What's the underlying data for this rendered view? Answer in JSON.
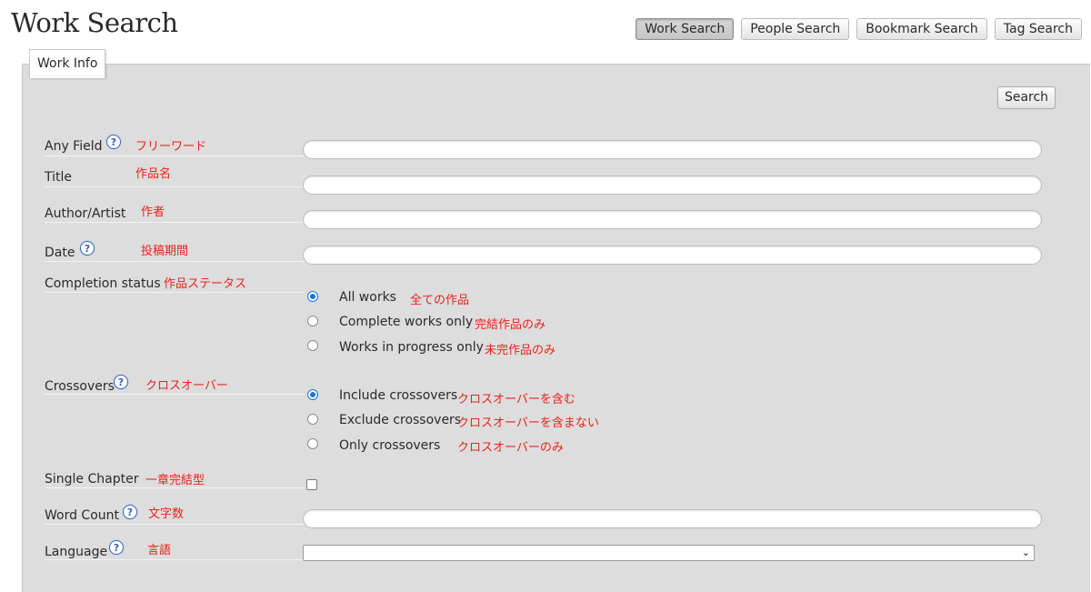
{
  "title": "Work Search",
  "nav": {
    "work_search": "Work Search",
    "people_search": "People Search",
    "bookmark_search": "Bookmark Search",
    "tag_search": "Tag Search"
  },
  "tab": {
    "label": "Work Info"
  },
  "search_button": "Search",
  "help_glyph": "?",
  "fields": {
    "any_field": {
      "label": "Any Field",
      "note": "フリーワード",
      "value": ""
    },
    "title": {
      "label": "Title",
      "note": "作品名",
      "value": ""
    },
    "author": {
      "label": "Author/Artist",
      "note": "作者",
      "value": ""
    },
    "date": {
      "label": "Date",
      "note": "投稿期間",
      "value": ""
    },
    "completion": {
      "label": "Completion status",
      "note": "作品ステータス",
      "options": [
        {
          "label": "All works",
          "note": "全ての作品",
          "checked": true
        },
        {
          "label": "Complete works only",
          "note": "完結作品のみ",
          "checked": false
        },
        {
          "label": "Works in progress only",
          "note": "未完作品のみ",
          "checked": false
        }
      ]
    },
    "crossovers": {
      "label": "Crossovers",
      "note": "クロスオーバー",
      "options": [
        {
          "label": "Include crossovers",
          "note": "クロスオーバーを含む",
          "checked": true
        },
        {
          "label": "Exclude crossovers",
          "note": "クロスオーバーを含まない",
          "checked": false
        },
        {
          "label": "Only crossovers",
          "note": "クロスオーバーのみ",
          "checked": false
        }
      ]
    },
    "single_chapter": {
      "label": "Single Chapter",
      "note": "一章完結型",
      "checked": false
    },
    "word_count": {
      "label": "Word Count",
      "note": "文字数",
      "value": ""
    },
    "language": {
      "label": "Language",
      "note": "言語",
      "selected": ""
    }
  },
  "colors": {
    "panel": "#dddddd",
    "annotation": "#e8231b",
    "help_icon": "#3a63b0",
    "radio_checked": "#1a73e8"
  }
}
